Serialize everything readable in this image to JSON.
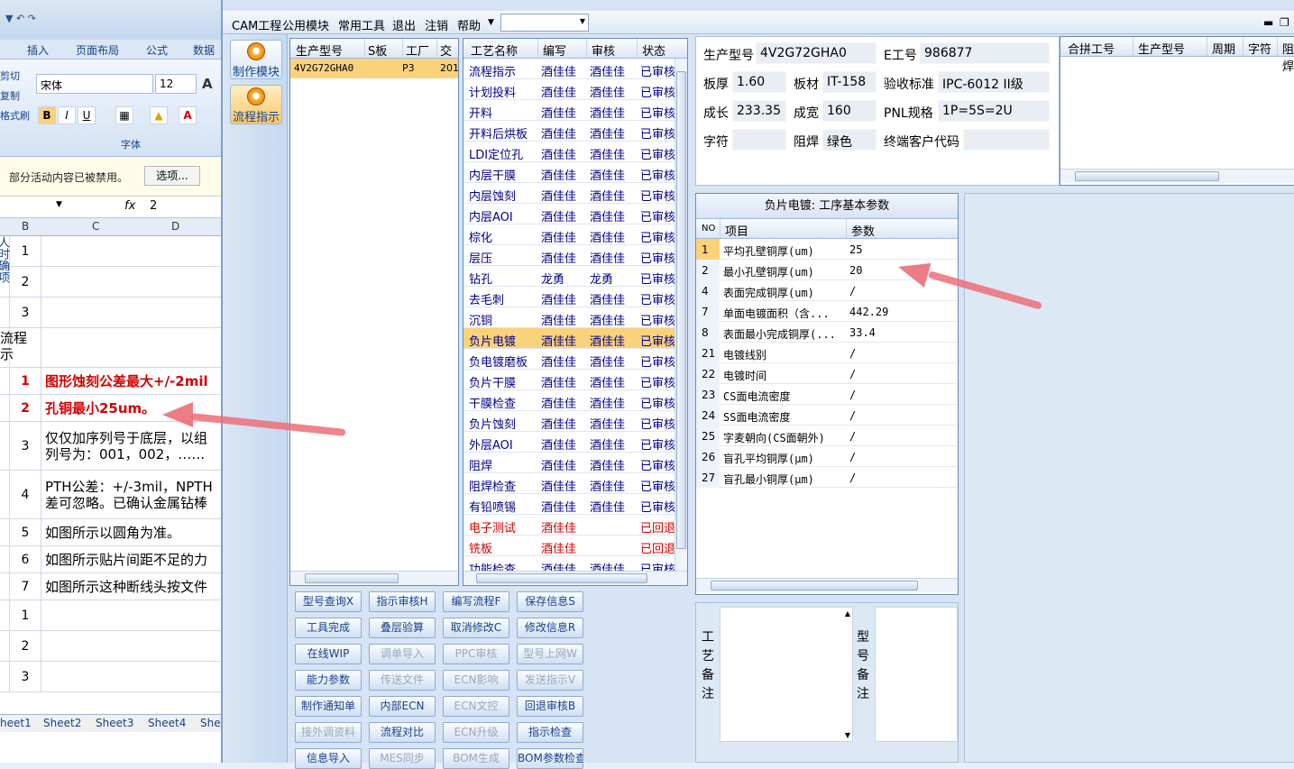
{
  "excel": {
    "ribbon_tabs": [
      "插入",
      "页面布局",
      "公式",
      "数据"
    ],
    "clipboard": [
      "剪切",
      "复制",
      "格式刷"
    ],
    "font_name": "宋体",
    "font_size": "12",
    "bold": "B",
    "italic": "I",
    "underline": "U",
    "font_color": "A",
    "group_font": "字体",
    "msg": "部分活动内容已被禁用。",
    "options_btn": "选项...",
    "fx": "fx",
    "formula_value": "2",
    "columns": [
      "B",
      "C",
      "D"
    ],
    "rows": [
      {
        "num": "1",
        "text": "",
        "red": false
      },
      {
        "num": "2",
        "text": "",
        "red": false
      },
      {
        "num": "3",
        "text": "",
        "red": false
      },
      {
        "num": "",
        "text": "",
        "red": false
      },
      {
        "num": "1",
        "text": "图形蚀刻公差最大+/-2mil",
        "red": true
      },
      {
        "num": "2",
        "text": "孔铜最小25um。",
        "red": true
      },
      {
        "num": "3",
        "text": "仅仅加序列号于底层，以组\n列号为：001，002，……",
        "red": false
      },
      {
        "num": "4",
        "text": "PTH公差：+/-3mil，NPTH\n差可忽略。已确认金属钻棒",
        "red": false
      },
      {
        "num": "5",
        "text": "如图所示以圆角为准。",
        "red": false
      },
      {
        "num": "6",
        "text": "如图所示贴片间距不足的力",
        "red": false
      },
      {
        "num": "7",
        "text": "如图所示这种断线头按文件",
        "red": false
      },
      {
        "num": "1",
        "text": "",
        "red": false
      },
      {
        "num": "2",
        "text": "",
        "red": false
      },
      {
        "num": "3",
        "text": "",
        "red": false
      }
    ],
    "side_label_top": "人时确项",
    "side_label_flow": "流程示",
    "sheets": [
      "heet1",
      "Sheet2",
      "Sheet3",
      "Sheet4",
      "She"
    ]
  },
  "menu": [
    "CAM工程",
    "公用模块",
    "常用工具",
    "退出",
    "注销",
    "帮助"
  ],
  "modules": [
    "制作模块",
    "流程指示"
  ],
  "model_grid": {
    "headers": [
      "生产型号",
      "S板",
      "工厂",
      "交头"
    ],
    "rows": [
      {
        "model": "4V2G72GHA0",
        "board": "P3",
        "factory": "201"
      }
    ]
  },
  "process_grid": {
    "headers": [
      "工艺名称",
      "编写",
      "审核",
      "状态"
    ],
    "rows": [
      {
        "name": "流程指示",
        "writer": "酒佳佳",
        "reviewer": "酒佳佳",
        "status": "已审核"
      },
      {
        "name": "计划投料",
        "writer": "酒佳佳",
        "reviewer": "酒佳佳",
        "status": "已审核"
      },
      {
        "name": "开料",
        "writer": "酒佳佳",
        "reviewer": "酒佳佳",
        "status": "已审核"
      },
      {
        "name": "开料后烘板",
        "writer": "酒佳佳",
        "reviewer": "酒佳佳",
        "status": "已审核"
      },
      {
        "name": "LDI定位孔",
        "writer": "酒佳佳",
        "reviewer": "酒佳佳",
        "status": "已审核"
      },
      {
        "name": "内层干膜",
        "writer": "酒佳佳",
        "reviewer": "酒佳佳",
        "status": "已审核"
      },
      {
        "name": "内层蚀刻",
        "writer": "酒佳佳",
        "reviewer": "酒佳佳",
        "status": "已审核"
      },
      {
        "name": "内层AOI",
        "writer": "酒佳佳",
        "reviewer": "酒佳佳",
        "status": "已审核"
      },
      {
        "name": "棕化",
        "writer": "酒佳佳",
        "reviewer": "酒佳佳",
        "status": "已审核"
      },
      {
        "name": "层压",
        "writer": "酒佳佳",
        "reviewer": "酒佳佳",
        "status": "已审核"
      },
      {
        "name": "钻孔",
        "writer": "龙勇",
        "reviewer": "龙勇",
        "status": "已审核"
      },
      {
        "name": "去毛刺",
        "writer": "酒佳佳",
        "reviewer": "酒佳佳",
        "status": "已审核"
      },
      {
        "name": "沉铜",
        "writer": "酒佳佳",
        "reviewer": "酒佳佳",
        "status": "已审核"
      },
      {
        "name": "负片电镀",
        "writer": "酒佳佳",
        "reviewer": "酒佳佳",
        "status": "已审核",
        "selected": true
      },
      {
        "name": "负电镀磨板",
        "writer": "酒佳佳",
        "reviewer": "酒佳佳",
        "status": "已审核"
      },
      {
        "name": "负片干膜",
        "writer": "酒佳佳",
        "reviewer": "酒佳佳",
        "status": "已审核"
      },
      {
        "name": "干膜检查",
        "writer": "酒佳佳",
        "reviewer": "酒佳佳",
        "status": "已审核"
      },
      {
        "name": "负片蚀刻",
        "writer": "酒佳佳",
        "reviewer": "酒佳佳",
        "status": "已审核"
      },
      {
        "name": "外层AOI",
        "writer": "酒佳佳",
        "reviewer": "酒佳佳",
        "status": "已审核"
      },
      {
        "name": "阻焊",
        "writer": "酒佳佳",
        "reviewer": "酒佳佳",
        "status": "已审核"
      },
      {
        "name": "阻焊检查",
        "writer": "酒佳佳",
        "reviewer": "酒佳佳",
        "status": "已审核"
      },
      {
        "name": "有铅喷锡",
        "writer": "酒佳佳",
        "reviewer": "酒佳佳",
        "status": "已审核"
      },
      {
        "name": "电子测试",
        "writer": "酒佳佳",
        "reviewer": "",
        "status": "已回退",
        "returned": true
      },
      {
        "name": "铣板",
        "writer": "酒佳佳",
        "reviewer": "",
        "status": "已回退",
        "returned": true
      },
      {
        "name": "功能检查",
        "writer": "酒佳佳",
        "reviewer": "酒佳佳",
        "status": "已审核"
      }
    ]
  },
  "info": {
    "model_label": "生产型号",
    "model_value": "4V2G72GHA0",
    "e_label": "E工号",
    "e_value": "986877",
    "thick_label": "板厚",
    "thick_value": "1.60",
    "material_label": "板材",
    "material_value": "IT-158",
    "std_label": "验收标准",
    "std_value": "IPC-6012 II级",
    "len_label": "成长",
    "len_value": "233.35",
    "wid_label": "成宽",
    "wid_value": "160",
    "pnl_label": "PNL规格",
    "pnl_value": "1P=5S=2U",
    "char_label": "字符",
    "char_value": "",
    "mask_label": "阻焊",
    "mask_value": "绿色",
    "cust_label": "终端客户代码",
    "cust_value": ""
  },
  "merge_grid": {
    "headers": [
      "合拼工号",
      "生产型号",
      "周期",
      "字符",
      "阻焊"
    ]
  },
  "params": {
    "title": "负片电镀: 工序基本参数",
    "headers": [
      "NO",
      "项目",
      "参数"
    ],
    "rows": [
      {
        "no": "1",
        "name": "平均孔壁铜厚(um)",
        "value": "25",
        "selected": true
      },
      {
        "no": "2",
        "name": "最小孔壁铜厚(um)",
        "value": "20"
      },
      {
        "no": "4",
        "name": "表面完成铜厚(um)",
        "value": "/"
      },
      {
        "no": "7",
        "name": "单面电镀面积（含...",
        "value": "442.29"
      },
      {
        "no": "8",
        "name": "表面最小完成铜厚(...",
        "value": "33.4"
      },
      {
        "no": "21",
        "name": "电镀线别",
        "value": "/"
      },
      {
        "no": "22",
        "name": "电镀时间",
        "value": "/"
      },
      {
        "no": "23",
        "name": "CS面电流密度",
        "value": "/"
      },
      {
        "no": "24",
        "name": "SS面电流密度",
        "value": "/"
      },
      {
        "no": "25",
        "name": "字麦朝向(CS面朝外)",
        "value": "/"
      },
      {
        "no": "26",
        "name": "盲孔平均铜厚(μm)",
        "value": "/"
      },
      {
        "no": "27",
        "name": "盲孔最小铜厚(μm)",
        "value": "/"
      }
    ]
  },
  "buttons": [
    {
      "label": "型号查询X",
      "disabled": false
    },
    {
      "label": "指示审核H",
      "disabled": false
    },
    {
      "label": "编写流程F",
      "disabled": false
    },
    {
      "label": "保存信息S",
      "disabled": false
    },
    {
      "label": "工具完成",
      "disabled": false
    },
    {
      "label": "叠层验算",
      "disabled": false
    },
    {
      "label": "取消修改C",
      "disabled": false
    },
    {
      "label": "修改信息R",
      "disabled": false
    },
    {
      "label": "在线WIP",
      "disabled": false
    },
    {
      "label": "调单导入",
      "disabled": true
    },
    {
      "label": "PPC审核",
      "disabled": true
    },
    {
      "label": "型号上网W",
      "disabled": true
    },
    {
      "label": "能力参数",
      "disabled": false
    },
    {
      "label": "传送文件",
      "disabled": true
    },
    {
      "label": "ECN影响",
      "disabled": true
    },
    {
      "label": "发送指示V",
      "disabled": true
    },
    {
      "label": "制作通知单",
      "disabled": false
    },
    {
      "label": "内部ECN",
      "disabled": false
    },
    {
      "label": "ECN文控",
      "disabled": true
    },
    {
      "label": "回退审核B",
      "disabled": false
    },
    {
      "label": "接外调资料",
      "disabled": true
    },
    {
      "label": "流程对比",
      "disabled": false
    },
    {
      "label": "ECN升级",
      "disabled": true
    },
    {
      "label": "指示检查",
      "disabled": false
    },
    {
      "label": "信息导入",
      "disabled": false
    },
    {
      "label": "MES同步",
      "disabled": true
    },
    {
      "label": "BOM生成",
      "disabled": true
    },
    {
      "label": "BOM参数检查",
      "disabled": false
    }
  ],
  "remarks": {
    "process_label": "工艺备注",
    "model_label": "型号备注"
  }
}
